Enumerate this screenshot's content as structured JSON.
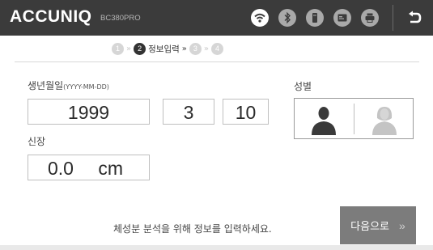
{
  "header": {
    "logo": "ACCUNIQ",
    "model": "BC380PRO",
    "icons": [
      "wifi-icon",
      "bluetooth-icon",
      "usb-icon",
      "card-icon",
      "printer-icon"
    ],
    "back_icon": "return-icon"
  },
  "steps": {
    "items": [
      "1",
      "2",
      "3",
      "4"
    ],
    "active_index": 1,
    "active_label": "정보입력",
    "separator": "»"
  },
  "form": {
    "birth_label": "생년월일",
    "birth_format": "(YYYY-MM-DD)",
    "year": "1999",
    "month": "3",
    "day": "10",
    "height_label": "신장",
    "height_value": "0.0",
    "height_unit": "cm",
    "gender_label": "성별",
    "gender_options": [
      "male",
      "female"
    ],
    "gender_selected": "male"
  },
  "footer": {
    "message": "체성분 분석을 위해 정보를 입력하세요.",
    "next_label": "다음으로",
    "next_chevron": "»"
  },
  "colors": {
    "header_bg": "#3b3b3b",
    "next_bg": "#7c7c7c",
    "active_step": "#333333",
    "inactive_step": "#d6d6d6"
  }
}
